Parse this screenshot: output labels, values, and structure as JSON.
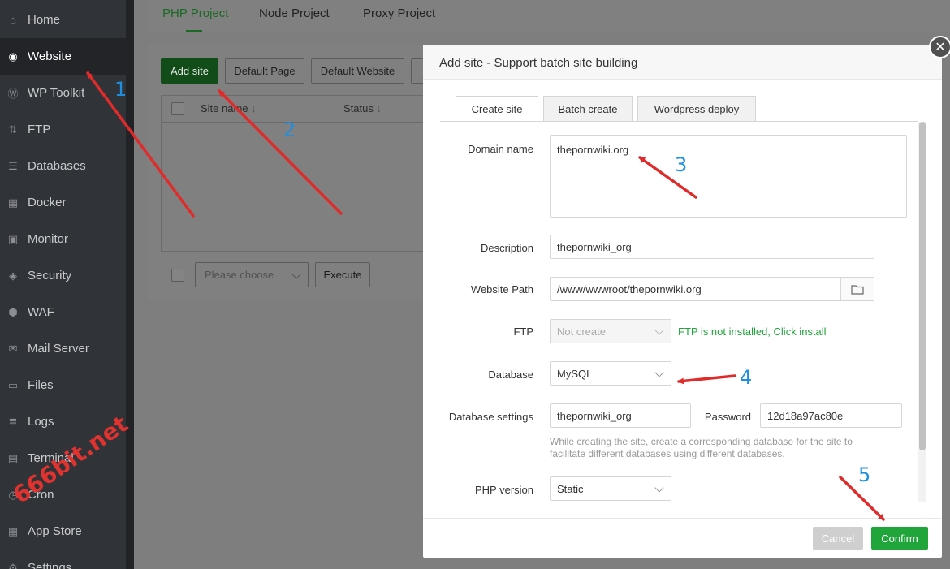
{
  "sidebar": {
    "items": [
      {
        "label": "Home",
        "icon": "home-icon",
        "glyph": "⌂"
      },
      {
        "label": "Website",
        "icon": "globe-icon",
        "glyph": "◉"
      },
      {
        "label": "WP Toolkit",
        "icon": "wordpress-icon",
        "glyph": "Ⓦ"
      },
      {
        "label": "FTP",
        "icon": "ftp-icon",
        "glyph": "⇅"
      },
      {
        "label": "Databases",
        "icon": "database-icon",
        "glyph": "☰"
      },
      {
        "label": "Docker",
        "icon": "docker-icon",
        "glyph": "▦"
      },
      {
        "label": "Monitor",
        "icon": "monitor-icon",
        "glyph": "▣"
      },
      {
        "label": "Security",
        "icon": "shield-icon",
        "glyph": "◈"
      },
      {
        "label": "WAF",
        "icon": "waf-shield-icon",
        "glyph": "⬢"
      },
      {
        "label": "Mail Server",
        "icon": "mail-icon",
        "glyph": "✉"
      },
      {
        "label": "Files",
        "icon": "folder-icon",
        "glyph": "▭"
      },
      {
        "label": "Logs",
        "icon": "logs-icon",
        "glyph": "≣"
      },
      {
        "label": "Terminal",
        "icon": "terminal-icon",
        "glyph": "▤"
      },
      {
        "label": "Cron",
        "icon": "clock-icon",
        "glyph": "◷"
      },
      {
        "label": "App Store",
        "icon": "grid-icon",
        "glyph": "▦"
      },
      {
        "label": "Settings",
        "icon": "gear-icon",
        "glyph": "⚙"
      }
    ]
  },
  "project_tabs": [
    "PHP Project",
    "Node Project",
    "Proxy Project"
  ],
  "toolbar": {
    "add_site": "Add site",
    "default_page": "Default Page",
    "default_website": "Default Website"
  },
  "table": {
    "columns": [
      "Site name",
      "Status"
    ],
    "sort_glyph": "↓"
  },
  "batch": {
    "select_placeholder": "Please choose",
    "execute": "Execute"
  },
  "modal": {
    "title": "Add site - Support batch site building",
    "close_glyph": "✕",
    "tabs": [
      "Create site",
      "Batch create",
      "Wordpress deploy"
    ],
    "domain_label": "Domain name",
    "domain_value": "thepornwiki.org",
    "description_label": "Description",
    "description_value": "thepornwiki_org",
    "path_label": "Website Path",
    "path_value": "/www/wwwroot/thepornwiki.org",
    "ftp_label": "FTP",
    "ftp_value": "Not create",
    "ftp_link": "FTP is not installed, Click install",
    "database_label": "Database",
    "database_value": "MySQL",
    "db_settings_label": "Database settings",
    "db_name_value": "thepornwiki_org",
    "password_label": "Password",
    "password_value": "12d18a97ac80e",
    "hint": "While creating the site, create a corresponding database for the site to facilitate different databases using different databases.",
    "php_label": "PHP version",
    "php_value": "Static",
    "cancel": "Cancel",
    "confirm": "Confirm"
  },
  "annotations": {
    "numbers": [
      "1",
      "2",
      "3",
      "4",
      "5"
    ],
    "arrow_color": "#e02b2b",
    "number_color": "#1d8fe1"
  },
  "watermark": "666bit.net"
}
